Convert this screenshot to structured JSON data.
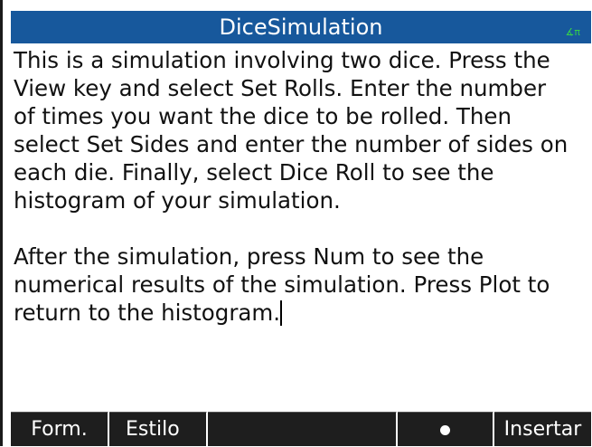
{
  "app": {
    "title": "DiceSimulation",
    "angle_indicator": "∡π"
  },
  "note": {
    "paragraph1": "This is a simulation involving two dice. Press the\nView key and select Set Rolls. Enter the number\nof times you want the dice to be rolled. Then\nselect Set Sides and enter the number of sides on\neach die. Finally, select Dice Roll to see the\nhistogram of your simulation.",
    "paragraph2": "After the simulation, press Num to see the\nnumerical results of the simulation. Press Plot to\nreturn to the histogram."
  },
  "softkeys": {
    "form_label": "Form.",
    "style_label": "Estilo",
    "empty_label": "",
    "bullet_icon": "bullet-dot",
    "insert_label": "Insertar"
  },
  "colors": {
    "titlebar": "#17589c",
    "menubar": "#1e1e1e",
    "angle_indicator": "#35d14a"
  }
}
